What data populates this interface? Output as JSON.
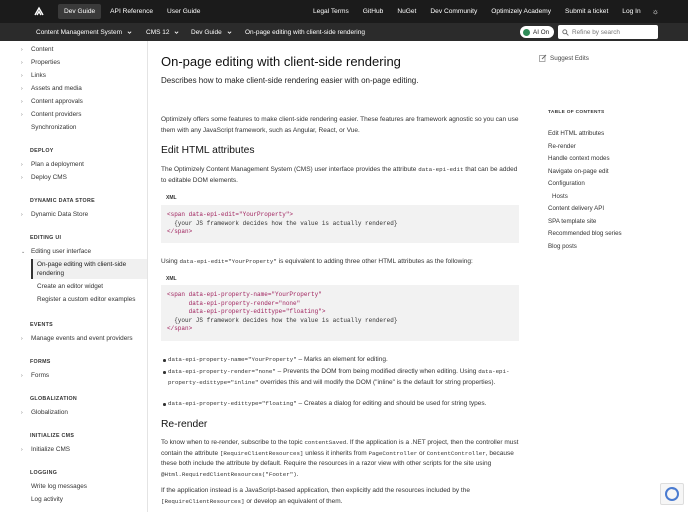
{
  "topbar": {
    "left_links": [
      "Dev Guide",
      "API Reference",
      "User Guide"
    ],
    "right_links": [
      "Legal Terms",
      "GitHub",
      "NuGet",
      "Dev Community",
      "Optimizely Academy",
      "Submit a ticket",
      "Log In"
    ]
  },
  "subbar": {
    "product": "Content Management System",
    "version": "CMS 12",
    "guide": "Dev Guide",
    "current_page": "On-page editing with client-side rendering",
    "ai_label": "AI On",
    "search_placeholder": "Refine by search"
  },
  "sidebar": {
    "top_items": [
      "Content",
      "Properties",
      "Links",
      "Assets and media",
      "Content approvals",
      "Content providers",
      "Synchronization"
    ],
    "sections": [
      {
        "heading": "DEPLOY",
        "items": [
          "Plan a deployment",
          "Deploy CMS"
        ]
      },
      {
        "heading": "DYNAMIC DATA STORE",
        "items": [
          "Dynamic Data Store"
        ]
      },
      {
        "heading": "EDITING UI",
        "items": [
          "Editing user interface",
          "On-page editing with client-side rendering",
          "Create an editor widget",
          "Register a custom editor examples"
        ]
      },
      {
        "heading": "EVENTS",
        "items": [
          "Manage events and event providers"
        ]
      },
      {
        "heading": "FORMS",
        "items": [
          "Forms"
        ]
      },
      {
        "heading": "GLOBALIZATION",
        "items": [
          "Globalization"
        ]
      },
      {
        "heading": "INITIALIZE CMS",
        "items": [
          "Initialize CMS"
        ]
      },
      {
        "heading": "LOGGING",
        "items": [
          "Write log messages",
          "Log activity"
        ]
      }
    ]
  },
  "main": {
    "title": "On-page editing with client-side rendering",
    "lede": "Describes how to make client-side rendering easier with on-page editing.",
    "intro": "Optimizely offers some features to make client-side rendering easier. These features are framework agnostic so you can use them with any JavaScript framework, such as Angular, React, or Vue.",
    "h2_edit": "Edit HTML attributes",
    "edit_p1": "The Optimizely Content Management System (CMS) user interface provides the attribute",
    "edit_p1_code": "data-epi-edit",
    "edit_p1_end": "that can be added to editable DOM elements.",
    "code_label_1": "XML",
    "code1": [
      "<span data-epi-edit=\"YourProperty\">",
      "  {your JS framework decides how the value is actually rendered}",
      "</span>"
    ],
    "using_1": "Using",
    "using_code": "data-epi-edit=\"YourProperty\"",
    "using_2": "is equivalent to adding three other HTML attributes as the following:",
    "code_label_2": "XML",
    "code2": [
      "<span data-epi-property-name=\"YourProperty\"",
      "      data-epi-property-render=\"none\"",
      "      data-epi-property-edittype=\"floating\">",
      "  {your JS framework decides how the value is actually rendered}",
      "</span>"
    ],
    "bullets": [
      {
        "code": "data-epi-property-name=\"YourProperty\"",
        "text": "– Marks an element for editing."
      },
      {
        "code": "data-epi-property-render=\"none\"",
        "text": "– Prevents the DOM from being modified directly when editing. Using",
        "code2": "data-epi-property-edittype=\"inline\"",
        "text2": "overrides this and will modify the DOM (\"inline\" is the default for string properties)."
      },
      {
        "code": "data-epi-property-edittype=\"floating\"",
        "text": "– Creates a dialog for editing and should be used for string types."
      }
    ],
    "h2_rerender": "Re-render",
    "rerender_p1a": "To know when to re-render, subscribe to the topic",
    "rerender_code1": "contentSaved",
    "rerender_p1b": ". If the application is a .NET project, then the controller must contain the attribute",
    "rerender_code2": "[RequireClientResources]",
    "rerender_p1c": "unless it inherits from",
    "rerender_code3": "PageController",
    "rerender_p1d": "or",
    "rerender_code4": "ContentController",
    "rerender_p1e": ", because these both include the attribute by default. Require the resources in a razor view with other scripts for the site using",
    "rerender_code5": "@Html.RequiredClientResources(\"Footer\")",
    "rerender_p1f": ".",
    "rerender_p2a": "If the application instead is a JavaScript-based application, then explicitly add the resources included by the",
    "rerender_code6": "[RequireClientResources]",
    "rerender_p2b": "or develop an equivalent of them."
  },
  "right": {
    "suggest_edits": "Suggest Edits",
    "toc_heading": "TABLE OF CONTENTS",
    "toc": [
      "Edit HTML attributes",
      "Re-render",
      "Handle context modes",
      "Navigate on-page edit",
      "Configuration",
      "Hosts",
      "Content delivery API",
      "SPA template site",
      "Recommended blog series",
      "Blog posts"
    ]
  }
}
